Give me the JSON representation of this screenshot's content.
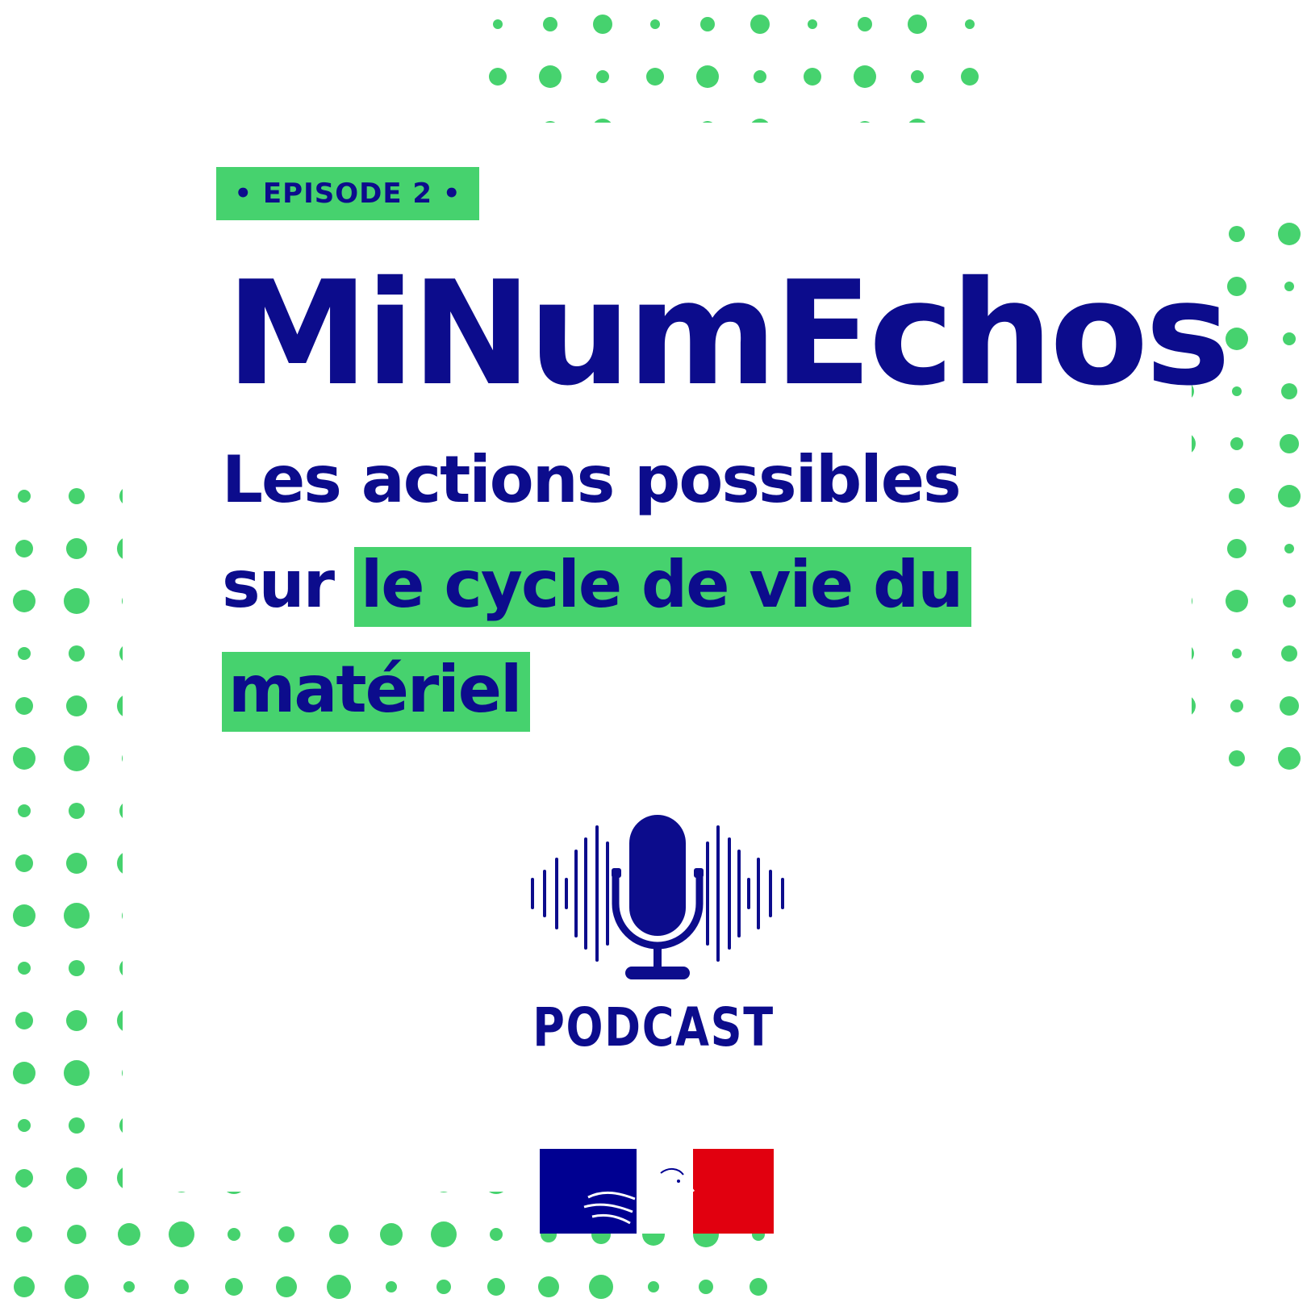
{
  "episode_label": "• EPISODE 2 •",
  "title": "MiNumEchos",
  "subtitle": {
    "line1": "Les actions possibles",
    "prefix": "sur ",
    "highlight1": "le cycle de vie du",
    "highlight2": "matériel"
  },
  "podcast_label": "PODCAST",
  "colors": {
    "navy": "#0c0c8c",
    "green": "#46d26e",
    "flag_blue": "#000091",
    "flag_red": "#e1000f"
  },
  "icons": [
    "microphone-icon",
    "marianne-flag-logo"
  ]
}
